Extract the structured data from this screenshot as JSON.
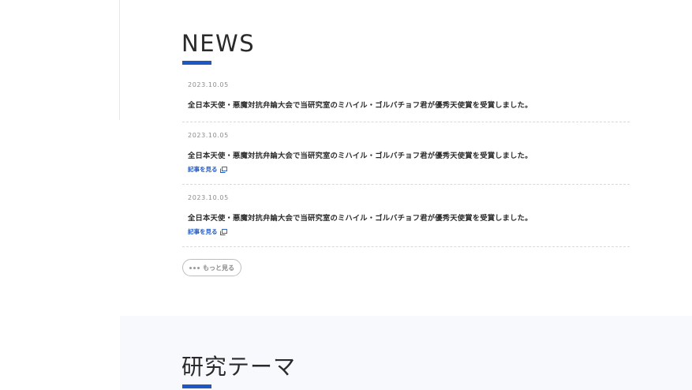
{
  "news": {
    "title": "NEWS",
    "items": [
      {
        "date": "2023.10.05",
        "text": "全日本天使・悪魔対抗弁論大会で当研究室のミハイル・ゴルバチョフ君が優秀天使賞を受賞しました。",
        "link_label": ""
      },
      {
        "date": "2023.10.05",
        "text": "全日本天使・悪魔対抗弁論大会で当研究室のミハイル・ゴルバチョフ君が優秀天使賞を受賞しました。",
        "link_label": "記事を見る"
      },
      {
        "date": "2023.10.05",
        "text": "全日本天使・悪魔対抗弁論大会で当研究室のミハイル・ゴルバチョフ君が優秀天使賞を受賞しました。",
        "link_label": "記事を見る"
      }
    ],
    "more_label": "もっと見る"
  },
  "research": {
    "title": "研究テーマ"
  },
  "colors": {
    "accent": "#1f57c3",
    "section_bg": "#f8f9fc",
    "text": "#2d2d2d",
    "muted": "#8c8c8c"
  },
  "icons": {
    "external_link": "external-link-icon",
    "more": "dots-icon"
  }
}
